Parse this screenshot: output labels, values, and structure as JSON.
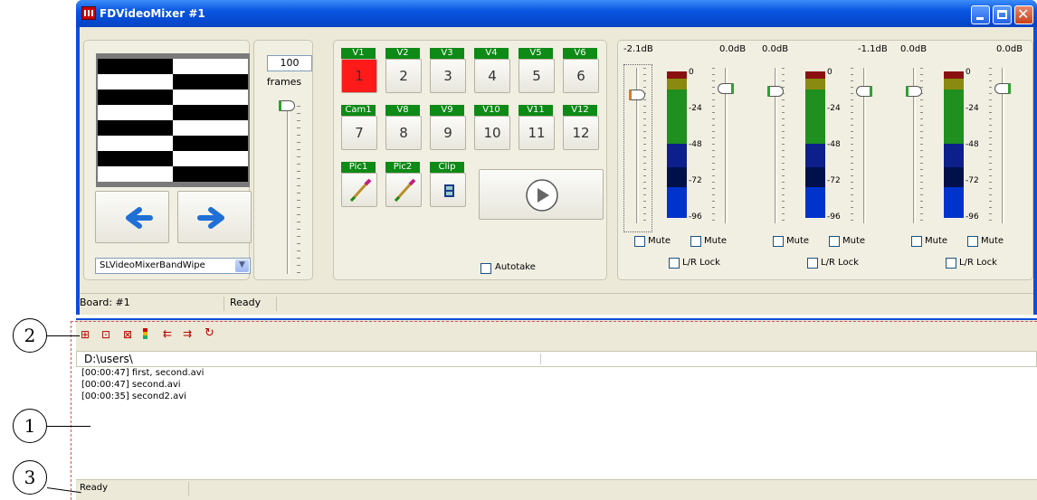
{
  "window": {
    "title": "FDVideoMixer #1"
  },
  "preview": {
    "effect_select": "SLVideoMixerBandWipe"
  },
  "frames": {
    "value": "100",
    "unit_label": "frames"
  },
  "channels": {
    "row1": [
      {
        "tag": "V1",
        "num": "1",
        "active": true
      },
      {
        "tag": "V2",
        "num": "2"
      },
      {
        "tag": "V3",
        "num": "3"
      },
      {
        "tag": "V4",
        "num": "4"
      },
      {
        "tag": "V5",
        "num": "5"
      },
      {
        "tag": "V6",
        "num": "6"
      }
    ],
    "row2": [
      {
        "tag": "Cam1",
        "num": "7"
      },
      {
        "tag": "V8",
        "num": "8"
      },
      {
        "tag": "V9",
        "num": "9"
      },
      {
        "tag": "V10",
        "num": "10"
      },
      {
        "tag": "V11",
        "num": "11"
      },
      {
        "tag": "V12",
        "num": "12"
      }
    ],
    "row3": [
      {
        "tag": "Pic1",
        "icon": "brush-icon"
      },
      {
        "tag": "Pic2",
        "icon": "brush-icon"
      },
      {
        "tag": "Clip",
        "icon": "film-icon"
      }
    ],
    "autotake_label": "Autotake"
  },
  "audio": {
    "groups": [
      {
        "left_db": "-2.1dB",
        "right_db": "0.0dB",
        "mute1": "Mute",
        "mute2": "Mute",
        "lock": "L/R Lock"
      },
      {
        "left_db": "0.0dB",
        "right_db": "-1.1dB",
        "mute1": "Mute",
        "mute2": "Mute",
        "lock": "L/R Lock"
      },
      {
        "left_db": "0.0dB",
        "right_db": "0.0dB",
        "mute1": "Mute",
        "mute2": "Mute",
        "lock": "L/R Lock"
      }
    ],
    "scale": [
      "0",
      "-24",
      "-48",
      "-72",
      "-96"
    ]
  },
  "statusbar": {
    "board": "Board: #1",
    "state": "Ready"
  },
  "log": {
    "path": "D:\\users\\",
    "entries": [
      "[00:00:47] first, second.avi",
      "[00:00:47] second.avi",
      "[00:00:35]  second2.avi"
    ],
    "status": "Ready"
  },
  "callouts": [
    "2",
    "1",
    "3"
  ],
  "colors": {
    "active_channel": "#ff1a1a",
    "channel_tag": "#0e8a16",
    "meter_green": "#1f8f1f",
    "meter_blue": "#0033cc"
  }
}
